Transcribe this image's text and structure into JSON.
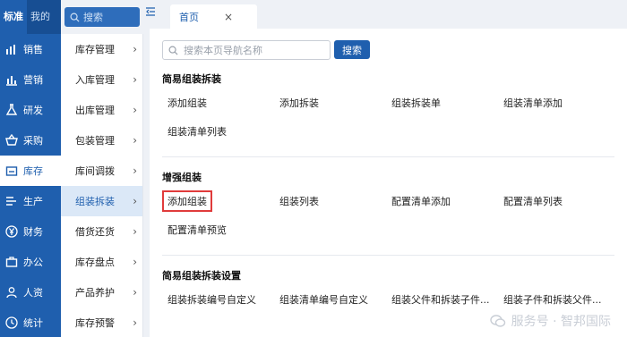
{
  "rail": {
    "tabs": [
      {
        "label": "标准"
      },
      {
        "label": "我的"
      }
    ],
    "items": [
      {
        "label": "销售",
        "icon": "chart-bar-icon"
      },
      {
        "label": "营销",
        "icon": "chart-column-icon"
      },
      {
        "label": "研发",
        "icon": "flask-icon"
      },
      {
        "label": "采购",
        "icon": "basket-icon"
      },
      {
        "label": "库存",
        "icon": "warehouse-icon"
      },
      {
        "label": "生产",
        "icon": "production-icon"
      },
      {
        "label": "财务",
        "icon": "yen-icon"
      },
      {
        "label": "办公",
        "icon": "briefcase-icon"
      },
      {
        "label": "人资",
        "icon": "person-icon"
      },
      {
        "label": "统计",
        "icon": "clock-icon"
      }
    ]
  },
  "side_search": {
    "placeholder": "搜索"
  },
  "submenu": {
    "items": [
      {
        "label": "库存管理"
      },
      {
        "label": "入库管理"
      },
      {
        "label": "出库管理"
      },
      {
        "label": "包装管理"
      },
      {
        "label": "库间调拨"
      },
      {
        "label": "组装拆装"
      },
      {
        "label": "借货还货"
      },
      {
        "label": "库存盘点"
      },
      {
        "label": "产品养护"
      },
      {
        "label": "库存预警"
      }
    ]
  },
  "tabbar": {
    "tab_label": "首页",
    "close_glyph": "×"
  },
  "main": {
    "search_placeholder": "搜索本页导航名称",
    "search_button": "搜索",
    "sections": [
      {
        "title": "简易组装拆装",
        "links": [
          "添加组装",
          "添加拆装",
          "组装拆装单",
          "组装清单添加",
          "组装清单列表"
        ]
      },
      {
        "title": "增强组装",
        "links": [
          "添加组装",
          "组装列表",
          "配置清单添加",
          "配置清单列表",
          "配置清单预览"
        ]
      },
      {
        "title": "简易组装拆装设置",
        "links": [
          "组装拆装编号自定义",
          "组装清单编号自定义",
          "组装父件和拆装子件...",
          "组装子件和拆装父件..."
        ]
      }
    ]
  },
  "watermark": {
    "text": "服务号 · 智邦国际"
  },
  "colors": {
    "brand": "#1f5fae",
    "highlight": "#e03b3b"
  }
}
